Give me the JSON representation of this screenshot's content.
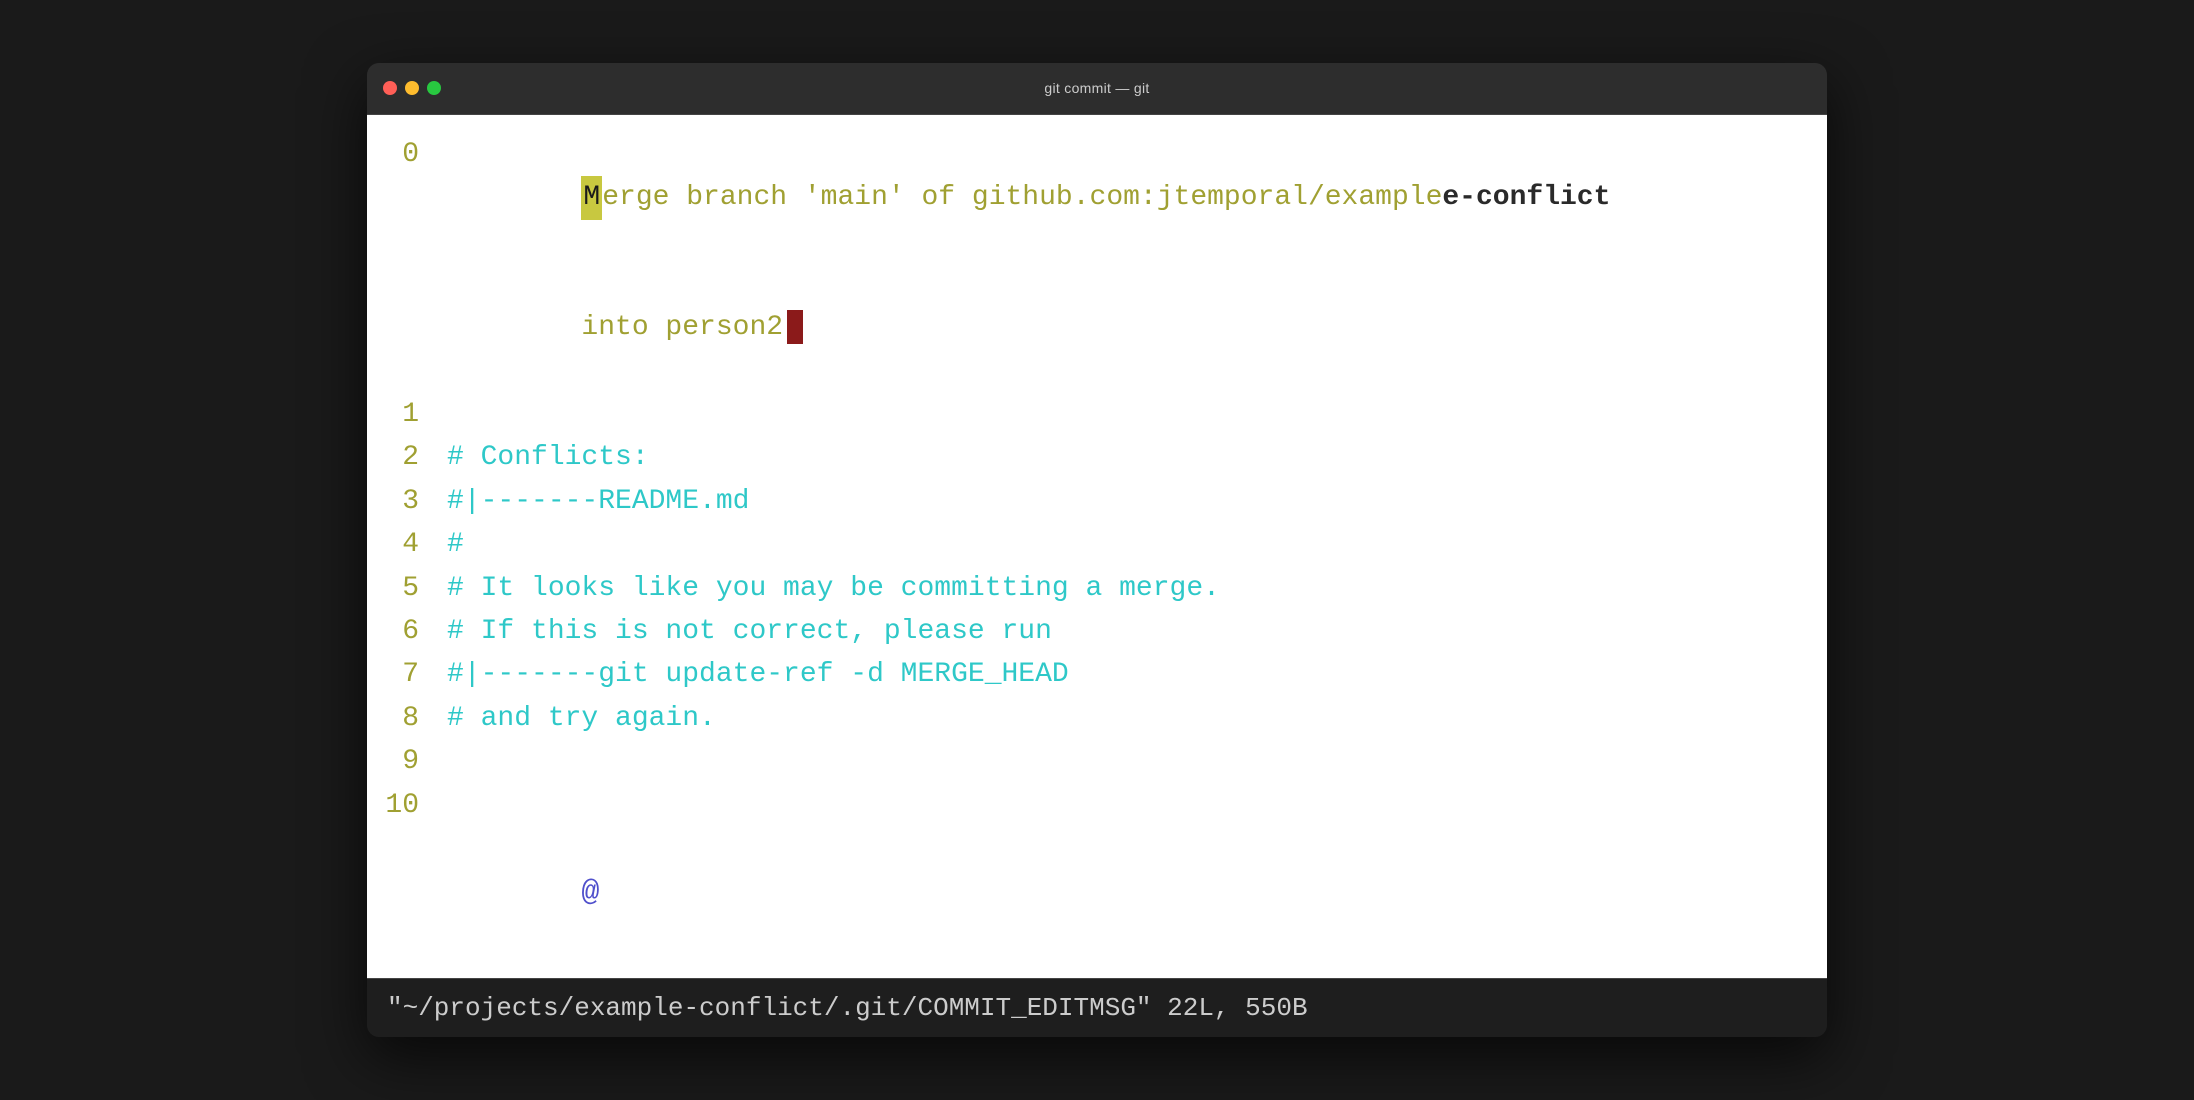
{
  "window": {
    "title": "git commit — git",
    "traffic_lights": {
      "close": "close",
      "minimize": "minimize",
      "maximize": "maximize"
    }
  },
  "editor": {
    "lines": [
      {
        "number": "0",
        "type": "code",
        "segments": [
          {
            "text": "Merge branch 'main' of github.com:jtemporal/example",
            "color": "yellow"
          },
          {
            "text": "e-conflict",
            "color": "white_bold"
          }
        ],
        "has_cursor_after": false
      },
      {
        "number": "",
        "type": "continuation",
        "text": "into person2",
        "color": "yellow",
        "has_cursor": true
      },
      {
        "number": "1",
        "type": "empty",
        "text": ""
      },
      {
        "number": "2",
        "type": "comment",
        "text": "# Conflicts:"
      },
      {
        "number": "3",
        "type": "comment",
        "text": "#|-------README.md"
      },
      {
        "number": "4",
        "type": "comment",
        "text": "#"
      },
      {
        "number": "5",
        "type": "comment",
        "text": "# It looks like you may be committing a merge."
      },
      {
        "number": "6",
        "type": "comment",
        "text": "# If this is not correct, please run"
      },
      {
        "number": "7",
        "type": "comment",
        "text": "#|-------git update-ref -d MERGE_HEAD"
      },
      {
        "number": "8",
        "type": "comment",
        "text": "# and try again."
      },
      {
        "number": "9",
        "type": "empty",
        "text": ""
      },
      {
        "number": "10",
        "type": "empty",
        "text": ""
      }
    ],
    "at_symbol": "@",
    "statusbar": "\"~/projects/example-conflict/.git/COMMIT_EDITMSG\" 22L, 550B"
  }
}
